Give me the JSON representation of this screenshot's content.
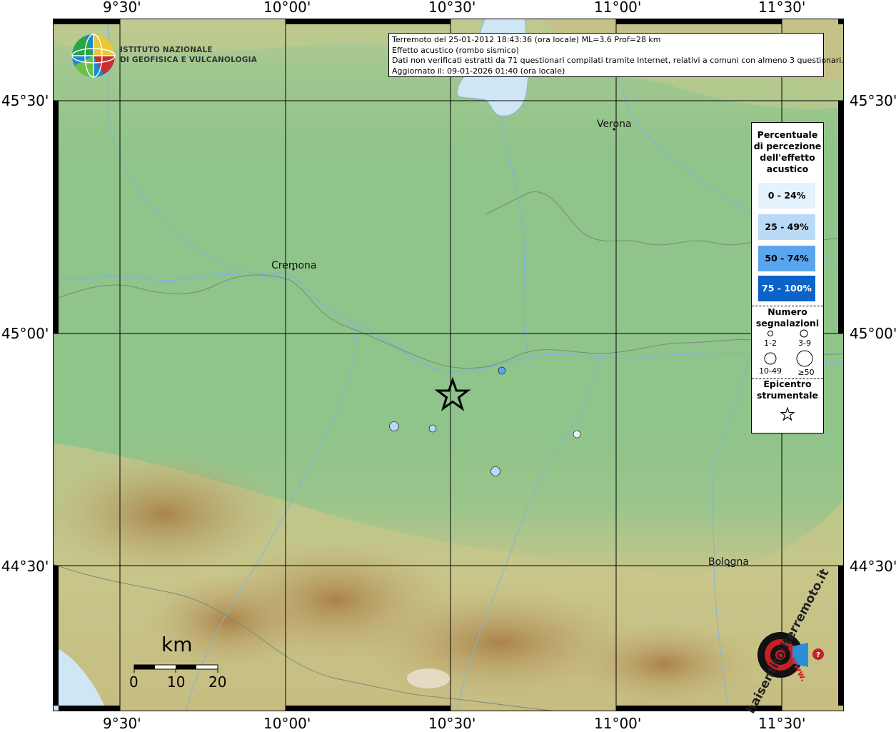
{
  "axes": {
    "lon_labels": [
      "9°30'",
      "10°00'",
      "10°30'",
      "11°00'",
      "11°30'"
    ],
    "lat_labels": [
      "45°30'",
      "45°00'",
      "44°30'"
    ]
  },
  "logo": {
    "line1": "ISTITUTO NAZIONALE",
    "line2": "DI GEOFISICA E VULCANOLOGIA"
  },
  "info": {
    "line1": "Terremoto del 25-01-2012 18:43:36 (ora locale) ML=3.6 Prof=28 km",
    "line2": "Effetto acustico (rombo sismico)",
    "line3": "Dati non verificati estratti da 71 questionari compilati tramite Internet, relativi a comuni con almeno 3 questionari.",
    "line4": "Aggiornato il: 09-01-2026 01:40 (ora locale)"
  },
  "legend": {
    "title": [
      "Percentuale",
      "di percezione",
      "dell'effetto",
      "acustico"
    ],
    "classes": [
      {
        "label": "0 - 24%",
        "color": "#e3f2fd",
        "text_color": "#000000"
      },
      {
        "label": "25 - 49%",
        "color": "#b9d9f7",
        "text_color": "#000000"
      },
      {
        "label": "50 - 74%",
        "color": "#5aa5ec",
        "text_color": "#000000"
      },
      {
        "label": "75 - 100%",
        "color": "#0b63c9",
        "text_color": "#ffffff"
      }
    ],
    "count_title": [
      "Numero",
      "segnalazioni"
    ],
    "count_classes": [
      "1-2",
      "3-9",
      "10-49",
      "≥50"
    ],
    "epicenter_title": [
      "Epicentro",
      "strumentale"
    ]
  },
  "cities": [
    "Verona",
    "Cremona",
    "Bologna"
  ],
  "scale": {
    "unit": "km",
    "ticks": [
      "0",
      "10",
      "20"
    ]
  },
  "points_percent_class": [
    "0 - 24%",
    "25 - 49%",
    "50 - 74%"
  ],
  "watermark": {
    "text": "haisentitoilterremoto.it",
    "url": "www."
  },
  "colors": {
    "plain": "#8fc48a",
    "hills": "#c7c58a",
    "mountains": "#b08850",
    "water": "#cfe6f5",
    "river": "#7fb6d9"
  }
}
